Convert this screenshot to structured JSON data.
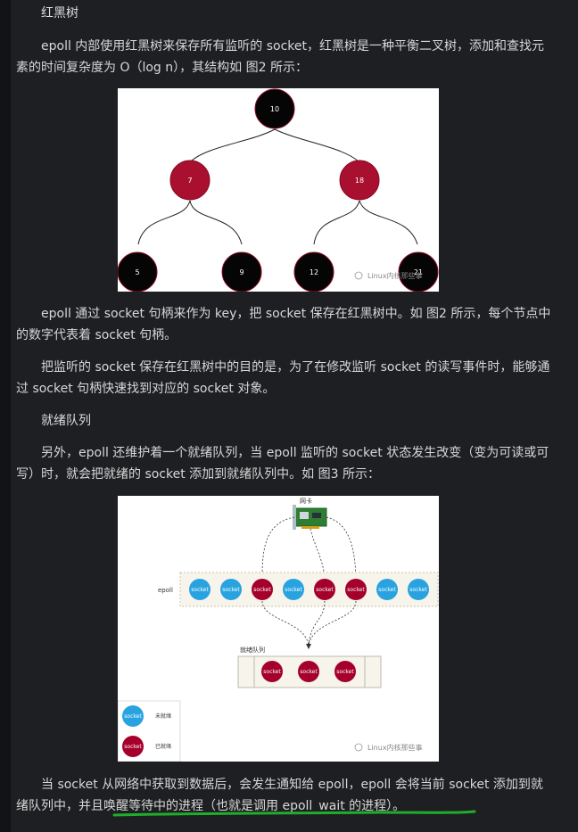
{
  "sections": {
    "rbtree_heading": "红黑树",
    "para1": "epoll 内部使用红黑树来保存所有监听的 socket，红黑树是一种平衡二叉树，添加和查找元素的时间复杂度为 O（log n），其结构如 图2 所示：",
    "para2": "epoll 通过 socket 句柄来作为 key，把 socket 保存在红黑树中。如 图2 所示，每个节点中的数字代表着 socket 句柄。",
    "para3": "把监听的 socket 保存在红黑树中的目的是，为了在修改监听 socket 的读写事件时，能够通过 socket 句柄快速找到对应的 socket 对象。",
    "ready_heading": "就绪队列",
    "para4": "另外，epoll 还维护着一个就绪队列，当 epoll 监听的 socket 状态发生改变（变为可读或可写）时，就会把就绪的 socket 添加到就绪队列中。如 图3 所示：",
    "para5_start": "当 socket 从网络中获取到数据后，会发生通知给 epoll，epoll 会将当前 socket 添加到就绪队列中，",
    "para5_underlined": "并且唤醒等待中的进程（也就是调用 epoll_wait 的进程）。"
  },
  "figure2": {
    "nodes": [
      {
        "label": "10",
        "color": "black"
      },
      {
        "label": "7",
        "color": "red"
      },
      {
        "label": "18",
        "color": "red"
      },
      {
        "label": "5",
        "color": "black"
      },
      {
        "label": "9",
        "color": "black"
      },
      {
        "label": "12",
        "color": "black"
      },
      {
        "label": "21",
        "color": "black"
      }
    ],
    "watermark": "Linux内核那些事"
  },
  "figure3": {
    "nic_label": "网卡",
    "epoll_label": "epoll",
    "queue_label": "就绪队列",
    "socket_label": "socket",
    "legend_unready": "未就绪",
    "legend_ready": "已就绪",
    "watermark": "Linux内核那些事",
    "colors": {
      "unready": "#29a3e0",
      "ready": "#a5002c"
    }
  },
  "colors": {
    "background": "#1e1f22",
    "text": "#d7d7d7",
    "underline": "#1fae2c",
    "node_red": "#a90f2f",
    "node_black": "#050505"
  }
}
